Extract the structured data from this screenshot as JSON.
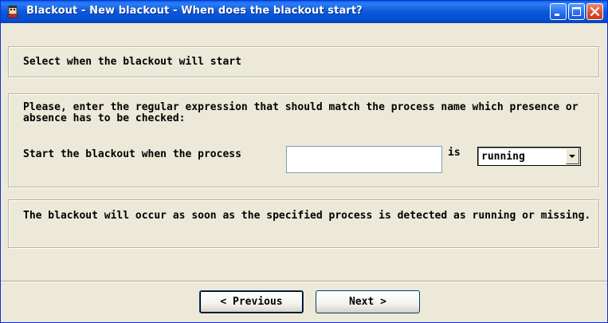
{
  "window": {
    "title": "Blackout - New blackout - When does the blackout start?",
    "icon": "blackout-app-icon",
    "controls": [
      "minimize-icon",
      "maximize-icon",
      "close-icon"
    ]
  },
  "header_panel": {
    "text": "Select when the blackout will start"
  },
  "process_panel": {
    "intro": "Please, enter the regular expression that should match the process name which presence or absence has to be checked:",
    "start_label": "Start the blackout when the process",
    "process_value": "",
    "is_label": "is",
    "state_value": "running"
  },
  "note_panel": {
    "text": "The blackout will occur as soon as the specified process is detected as running or missing."
  },
  "buttons": {
    "previous": "< Previous",
    "next": "Next >"
  },
  "colors": {
    "titlebar": "#0a58d8",
    "dialog_bg": "#ece9d8",
    "close_button": "#e0502e"
  }
}
